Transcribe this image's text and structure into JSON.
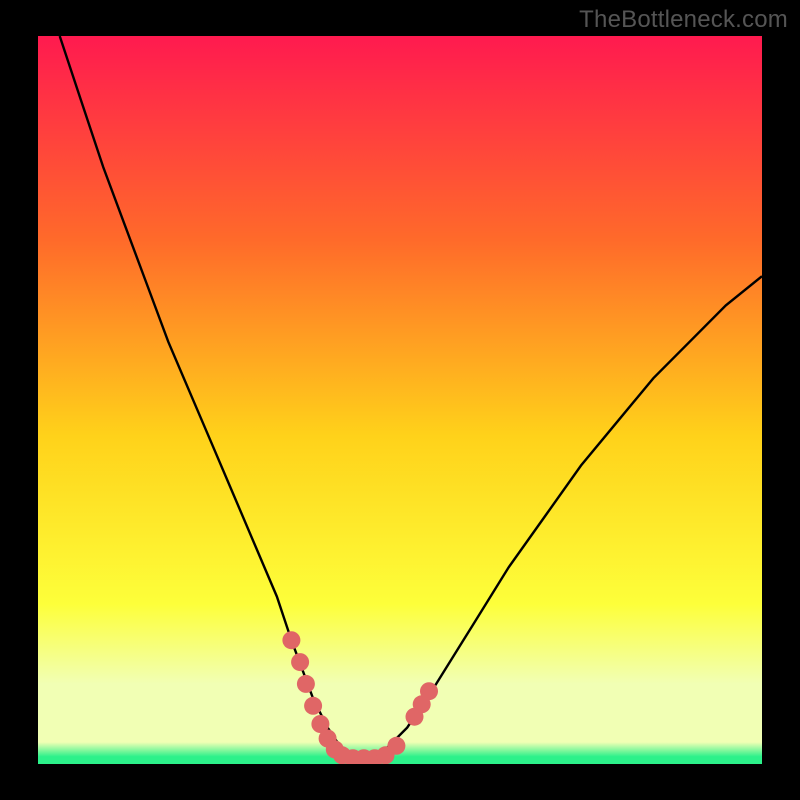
{
  "watermark": "TheBottleneck.com",
  "colors": {
    "background": "#000000",
    "gradient_top": "#ff1a4f",
    "gradient_mid1": "#ff6a2a",
    "gradient_mid2": "#ffd21a",
    "gradient_mid3": "#fdff3a",
    "gradient_bottom_band": "#f1ffb4",
    "gradient_green": "#2cf18a",
    "curve_stroke": "#000000",
    "marker_fill": "#e06666"
  },
  "chart_data": {
    "type": "line",
    "title": "",
    "xlabel": "",
    "ylabel": "",
    "xlim": [
      0,
      100
    ],
    "ylim": [
      0,
      100
    ],
    "series": [
      {
        "name": "bottleneck-curve",
        "x": [
          3,
          6,
          9,
          12,
          15,
          18,
          21,
          24,
          27,
          30,
          33,
          35,
          36.5,
          38,
          40,
          42,
          44,
          46,
          48,
          51,
          55,
          60,
          65,
          70,
          75,
          80,
          85,
          90,
          95,
          100
        ],
        "y": [
          100,
          91,
          82,
          74,
          66,
          58,
          51,
          44,
          37,
          30,
          23,
          17,
          13,
          9,
          5,
          2,
          1,
          1,
          2,
          5,
          11,
          19,
          27,
          34,
          41,
          47,
          53,
          58,
          63,
          67
        ]
      }
    ],
    "markers": [
      {
        "x": 35.0,
        "y": 17.0
      },
      {
        "x": 36.2,
        "y": 14.0
      },
      {
        "x": 37.0,
        "y": 11.0
      },
      {
        "x": 38.0,
        "y": 8.0
      },
      {
        "x": 39.0,
        "y": 5.5
      },
      {
        "x": 40.0,
        "y": 3.5
      },
      {
        "x": 41.0,
        "y": 2.0
      },
      {
        "x": 42.0,
        "y": 1.2
      },
      {
        "x": 43.5,
        "y": 0.8
      },
      {
        "x": 45.0,
        "y": 0.8
      },
      {
        "x": 46.5,
        "y": 0.8
      },
      {
        "x": 48.0,
        "y": 1.2
      },
      {
        "x": 49.5,
        "y": 2.5
      },
      {
        "x": 52.0,
        "y": 6.5
      },
      {
        "x": 53.0,
        "y": 8.2
      },
      {
        "x": 54.0,
        "y": 10.0
      }
    ]
  }
}
